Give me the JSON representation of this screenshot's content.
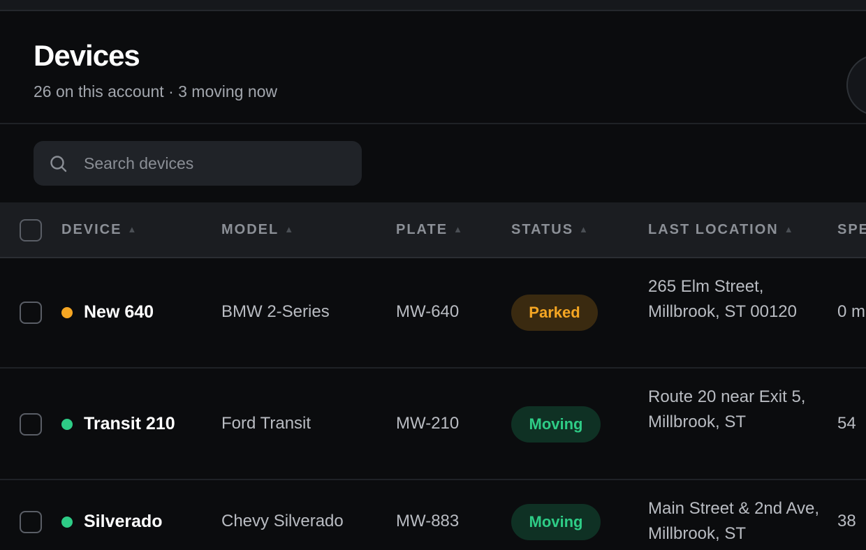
{
  "header": {
    "title": "Devices",
    "subtitle": "26 on this account · 3 moving now"
  },
  "search": {
    "placeholder": "Search devices",
    "icon": "search-icon"
  },
  "table": {
    "columns": [
      {
        "label": "DEVICE",
        "sortable": true
      },
      {
        "label": "MODEL",
        "sortable": true
      },
      {
        "label": "PLATE",
        "sortable": true
      },
      {
        "label": "STATUS",
        "sortable": true
      },
      {
        "label": "LAST LOCATION",
        "sortable": true
      },
      {
        "label": "SPE",
        "sortable": false
      }
    ],
    "sort_glyph": "▲",
    "rows": [
      {
        "name": "New 640",
        "model": "BMW 2-Series",
        "plate": "MW-640",
        "status": "Parked",
        "location": "265 Elm Street, Millbrook, ST 00120",
        "speed": "0 m",
        "dot_color": "#f5a623"
      },
      {
        "name": "Transit 210",
        "model": "Ford Transit",
        "plate": "MW-210",
        "status": "Moving",
        "location": "Route 20 near Exit 5, Millbrook, ST",
        "speed": "54",
        "dot_color": "#2ecc86"
      },
      {
        "name": "Silverado",
        "model": "Chevy Silverado",
        "plate": "MW-883",
        "status": "Moving",
        "location": "Main Street & 2nd Ave, Millbrook, ST",
        "speed": "38",
        "dot_color": "#2ecc86"
      }
    ]
  },
  "colors": {
    "background": "#0b0c0e",
    "parked": "#f5a623",
    "moving": "#2ecc86"
  }
}
